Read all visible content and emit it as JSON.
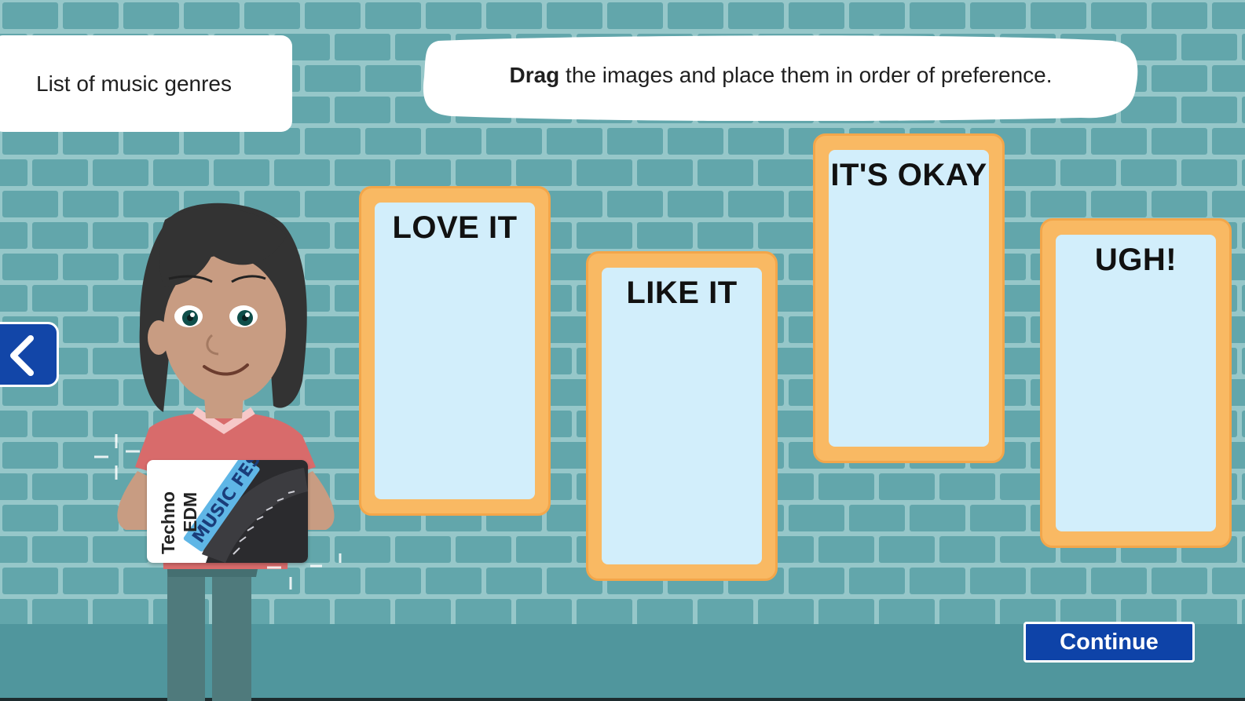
{
  "title_card": {
    "text": "List of music genres"
  },
  "instruction": {
    "bold": "Drag",
    "rest": " the images and place them in order of preference."
  },
  "drop_zones": [
    {
      "label": "LOVE IT"
    },
    {
      "label": "LIKE IT"
    },
    {
      "label": "IT'S OKAY"
    },
    {
      "label": "UGH!"
    }
  ],
  "draggable_card": {
    "line1": "Techno",
    "line2": "EDM",
    "image_icon": "music-fest-sign-icon"
  },
  "navigation": {
    "back_icon": "chevron-left-icon",
    "continue_label": "Continue"
  },
  "colors": {
    "wall": "#5fa3a9",
    "brick": "#6aaeb4",
    "floor": "#50969d",
    "zone_frame": "#f9b963",
    "zone_inner": "#d2eefb",
    "button_blue": "#0e43a8"
  }
}
